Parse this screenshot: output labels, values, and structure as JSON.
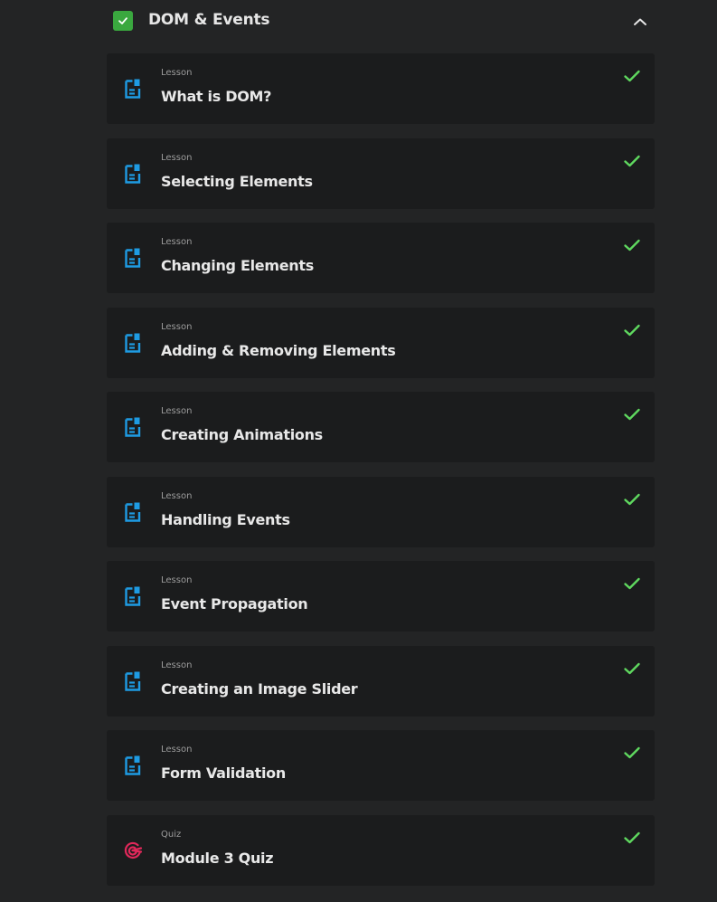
{
  "module": {
    "title": "DOM & Events",
    "completed": true,
    "expanded": true,
    "check_color": "#3aa83f"
  },
  "colors": {
    "lesson_icon": "#1e9be3",
    "quiz_icon": "#e0285a",
    "done_check": "#5fd85f"
  },
  "items": [
    {
      "type": "Lesson",
      "title": "What is DOM?",
      "icon": "document-icon",
      "completed": true
    },
    {
      "type": "Lesson",
      "title": "Selecting Elements",
      "icon": "document-icon",
      "completed": true
    },
    {
      "type": "Lesson",
      "title": "Changing Elements",
      "icon": "document-icon",
      "completed": true
    },
    {
      "type": "Lesson",
      "title": "Adding & Removing Elements",
      "icon": "document-icon",
      "completed": true
    },
    {
      "type": "Lesson",
      "title": "Creating Animations",
      "icon": "document-icon",
      "completed": true
    },
    {
      "type": "Lesson",
      "title": "Handling Events",
      "icon": "document-icon",
      "completed": true
    },
    {
      "type": "Lesson",
      "title": "Event Propagation",
      "icon": "document-icon",
      "completed": true
    },
    {
      "type": "Lesson",
      "title": "Creating an Image Slider",
      "icon": "document-icon",
      "completed": true
    },
    {
      "type": "Lesson",
      "title": "Form Validation",
      "icon": "document-icon",
      "completed": true
    },
    {
      "type": "Quiz",
      "title": "Module 3 Quiz",
      "icon": "target-icon",
      "completed": true
    }
  ]
}
